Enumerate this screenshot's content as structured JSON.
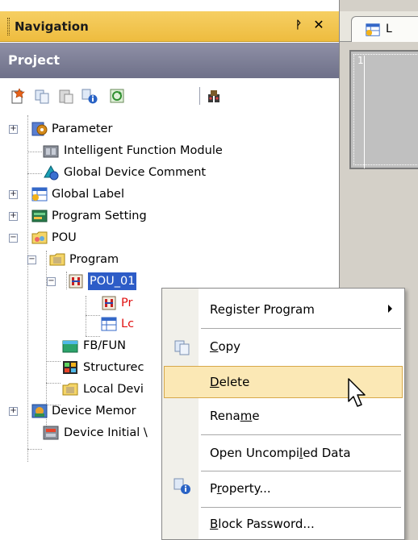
{
  "nav": {
    "title": "Navigation",
    "pin_glyph": "ᚹ",
    "close_glyph": "✕",
    "project_label": "Project",
    "toolbar_icons": [
      "new-data-icon",
      "copy-data-icon",
      "paste-data-icon",
      "property-icon",
      "refresh-icon",
      "find-icon"
    ]
  },
  "tree": {
    "parameter": "Parameter",
    "intelligent": "Intelligent Function Module",
    "global_comment": "Global Device Comment",
    "global_label": "Global Label",
    "program_setting": "Program Setting",
    "pou": "POU",
    "program": "Program",
    "pou_item": "POU_01",
    "pou_program_child": "Pr",
    "pou_local_child": "Lc",
    "fbfun": "FB/FUN",
    "structured": "Structurec",
    "local_device": "Local Devi",
    "device_memory": "Device Memor",
    "device_initial": "Device Initial \\"
  },
  "editor": {
    "tab_label": "L",
    "rung_number": "1"
  },
  "menu": {
    "register_program": [
      "Register Pro",
      "g",
      "ram"
    ],
    "copy": [
      "",
      "C",
      "opy"
    ],
    "delete": [
      "",
      "D",
      "elete"
    ],
    "rename": [
      "Rena",
      "m",
      "e"
    ],
    "open_uncompiled": [
      "Open Uncompi",
      "l",
      "ed Data"
    ],
    "property": [
      "P",
      "r",
      "operty..."
    ],
    "block_password": [
      "",
      "B",
      "lock Password..."
    ]
  },
  "colors": {
    "nav_header": "#eebc3f",
    "project_bar": "#7b7c95",
    "selection": "#2d5cc7",
    "menu_highlight": "#fbe8b5",
    "red_text": "#e01010"
  }
}
